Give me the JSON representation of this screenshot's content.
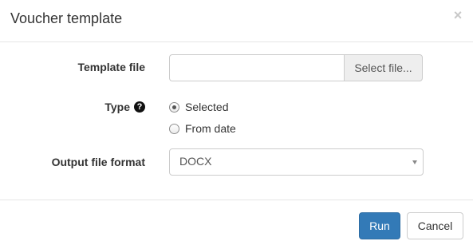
{
  "dialog": {
    "title": "Voucher template",
    "close_glyph": "×"
  },
  "form": {
    "template_file": {
      "label": "Template file",
      "value": "",
      "button_label": "Select file..."
    },
    "type": {
      "label": "Type",
      "help_icon": "question-circle-icon",
      "help_glyph": "?",
      "options": [
        {
          "label": "Selected",
          "checked": true
        },
        {
          "label": "From date",
          "checked": false
        }
      ]
    },
    "output_format": {
      "label": "Output file format",
      "selected": "DOCX"
    }
  },
  "footer": {
    "run_label": "Run",
    "cancel_label": "Cancel"
  },
  "colors": {
    "primary": "#337ab7",
    "border": "#cccccc",
    "divider": "#e5e5e5"
  }
}
